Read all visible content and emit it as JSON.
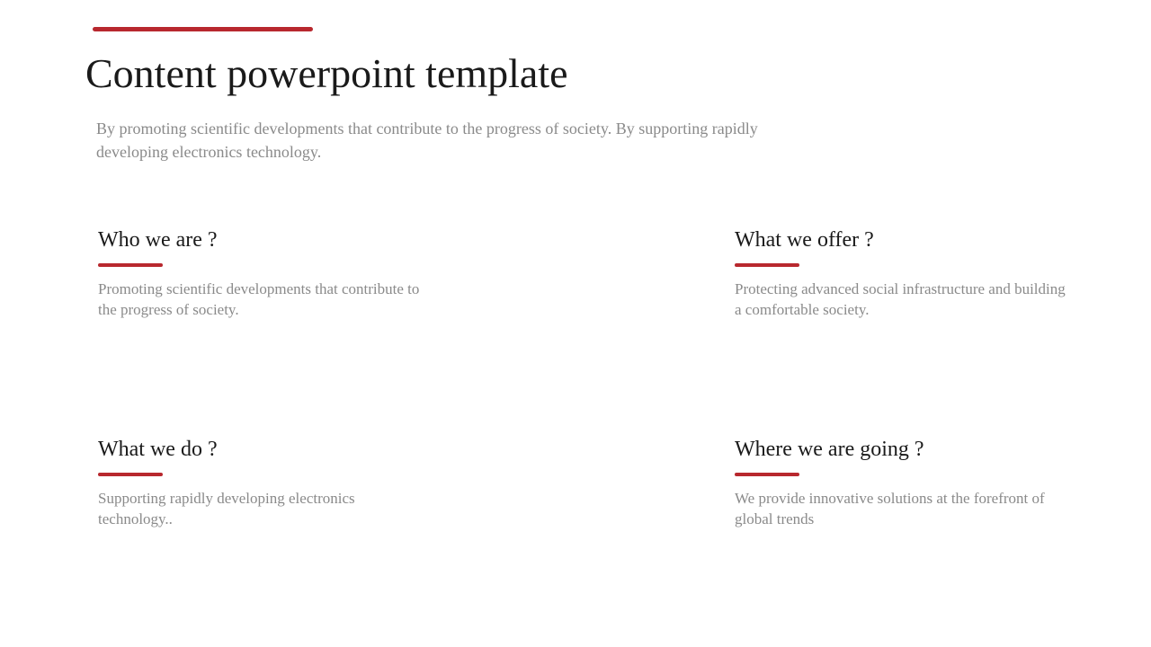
{
  "title": "Content powerpoint template",
  "subtitle": "By promoting scientific developments that contribute to the progress of society. By supporting rapidly developing electronics technology.",
  "sections": [
    {
      "heading": "Who we are ?",
      "body": "Promoting scientific developments that contribute to the progress of society."
    },
    {
      "heading": "What we offer ?",
      "body": "Protecting advanced social infrastructure and building a comfortable society."
    },
    {
      "heading": "What we do ?",
      "body": "Supporting rapidly developing electronics technology.."
    },
    {
      "heading": "Where we are going ?",
      "body": "We provide innovative solutions at the forefront of global trends"
    }
  ]
}
